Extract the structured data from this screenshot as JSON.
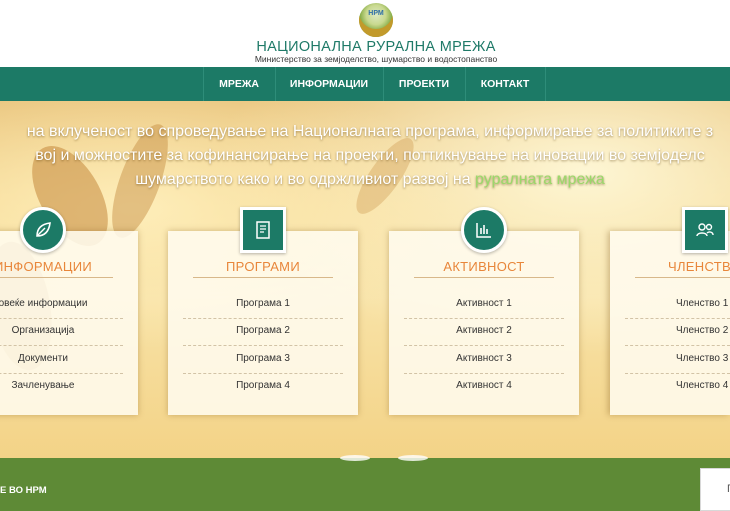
{
  "header": {
    "logo_text": "НРМ",
    "title": "НАЦИОНАЛНА РУРАЛНА МРЕЖА",
    "subtitle": "Министерство за земјоделство, шумарство и водостопанство"
  },
  "nav": {
    "items": [
      "МРЕЖА",
      "ИНФОРМАЦИИ",
      "ПРОЕКТИ",
      "КОНТАКТ"
    ]
  },
  "hero": {
    "line1": "на вклученост во спроведување на Националната програма, информирање за политиките з",
    "line2": "вој и можностите за кофинансирање на проекти, поттикнување на иновации во земјоделс",
    "line3_prefix": "шумарството како и во одржливиот развој на ",
    "line3_highlight": "руралната мрежа"
  },
  "cards": [
    {
      "icon": "leaf-icon",
      "title": "ИНФОРМАЦИИ",
      "items": [
        "овеќе информации",
        "Организација",
        "Документи",
        "Зачленување"
      ]
    },
    {
      "icon": "book-icon",
      "title": "ПРОГРАМИ",
      "items": [
        "Програма 1",
        "Програма 2",
        "Програма 3",
        "Програма 4"
      ]
    },
    {
      "icon": "chart-icon",
      "title": "АКТИВНОСТ",
      "items": [
        "Активност 1",
        "Активност 2",
        "Активност 3",
        "Активност 4"
      ]
    },
    {
      "icon": "users-icon",
      "title": "ЧЛЕНСТВ",
      "items": [
        "Членство 1",
        "Членство 2",
        "Членство 3",
        "Членство 4"
      ]
    }
  ],
  "bottom": {
    "label": "Е ВО НРМ",
    "box_text": "П"
  },
  "colors": {
    "brand_green": "#1c7a66",
    "accent_orange": "#e8863a",
    "footer_green": "#5e8a36",
    "highlight_green": "#9bd86a"
  }
}
